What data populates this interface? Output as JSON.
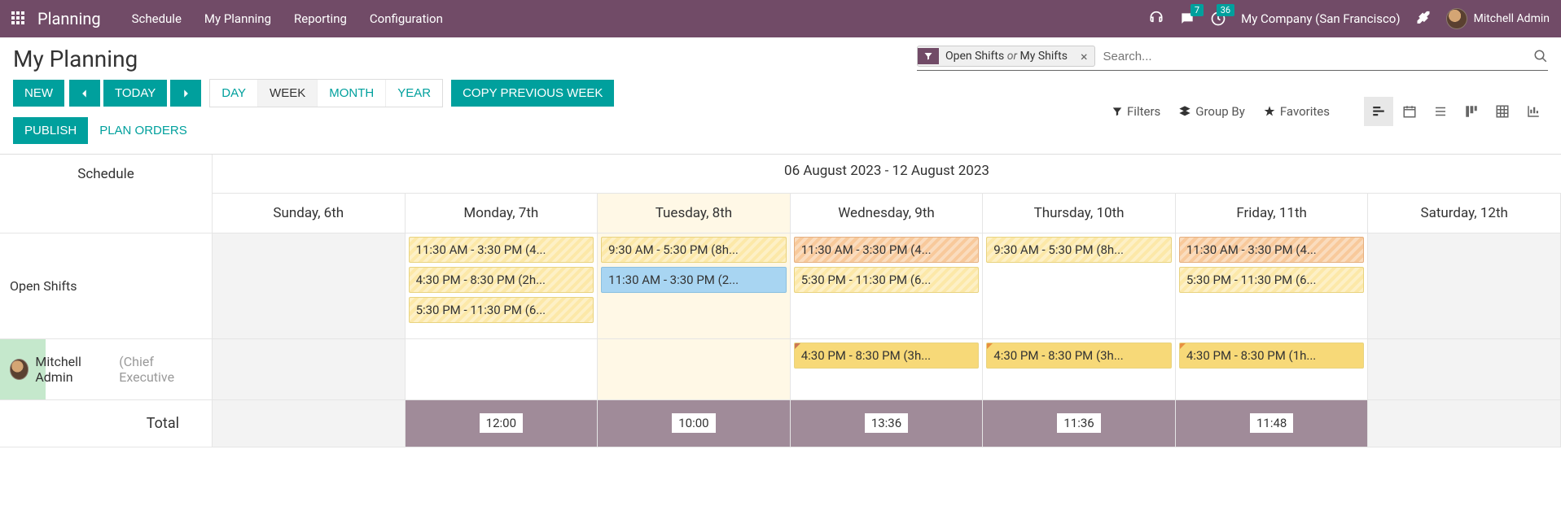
{
  "topnav": {
    "brand": "Planning",
    "items": [
      "Schedule",
      "My Planning",
      "Reporting",
      "Configuration"
    ],
    "messages_badge": "7",
    "activities_badge": "36",
    "company": "My Company (San Francisco)",
    "username": "Mitchell Admin"
  },
  "page": {
    "title": "My Planning",
    "new_btn": "NEW",
    "today_btn": "TODAY",
    "scales": {
      "day": "DAY",
      "week": "WEEK",
      "month": "MONTH",
      "year": "YEAR"
    },
    "copy_btn": "COPY PREVIOUS WEEK",
    "publish_btn": "PUBLISH",
    "plan_orders_btn": "PLAN ORDERS"
  },
  "search": {
    "facet_pre": "Open Shifts ",
    "facet_or": "or",
    "facet_post": " My Shifts",
    "placeholder": "Search...",
    "filters": "Filters",
    "groupby": "Group By",
    "favorites": "Favorites"
  },
  "gantt": {
    "range": "06 August 2023 - 12 August 2023",
    "schedule_label": "Schedule",
    "days": [
      "Sunday, 6th",
      "Monday, 7th",
      "Tuesday, 8th",
      "Wednesday, 9th",
      "Thursday, 10th",
      "Friday, 11th",
      "Saturday, 12th"
    ],
    "today_index": 2,
    "rows": [
      {
        "label": "Open Shifts"
      },
      {
        "label": "Mitchell Admin",
        "role": "(Chief Executive"
      }
    ],
    "open_mon": [
      "11:30 AM - 3:30 PM (4...",
      "4:30 PM - 8:30 PM (2h...",
      "5:30 PM - 11:30 PM (6..."
    ],
    "open_tue": [
      "9:30 AM - 5:30 PM (8h...",
      "11:30 AM - 3:30 PM (2..."
    ],
    "open_wed": [
      "11:30 AM - 3:30 PM (4...",
      "5:30 PM - 11:30 PM (6..."
    ],
    "open_thu": [
      "9:30 AM - 5:30 PM (8h..."
    ],
    "open_fri": [
      "11:30 AM - 3:30 PM (4...",
      "5:30 PM - 11:30 PM (6..."
    ],
    "ma_wed": "4:30 PM - 8:30 PM (3h...",
    "ma_thu": "4:30 PM - 8:30 PM (3h...",
    "ma_fri": "4:30 PM - 8:30 PM (1h...",
    "total_label": "Total",
    "totals": [
      "",
      "12:00",
      "10:00",
      "13:36",
      "11:36",
      "11:48",
      ""
    ]
  }
}
